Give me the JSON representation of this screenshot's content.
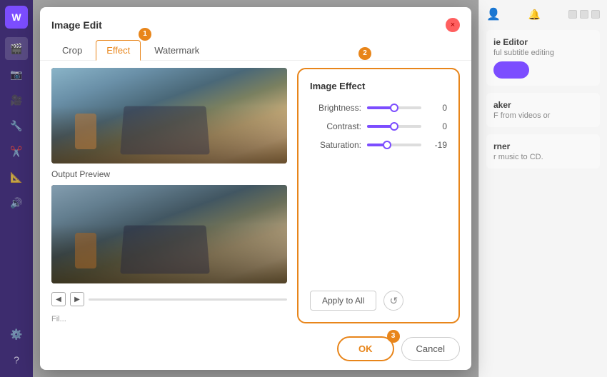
{
  "sidebar": {
    "logo_text": "W",
    "icons": [
      "🎬",
      "📷",
      "🎥",
      "🔧",
      "✂️",
      "📐",
      "🔊",
      "⚙️",
      "?"
    ]
  },
  "dialog": {
    "title": "Image Edit",
    "close_label": "×",
    "tabs": [
      {
        "id": "crop",
        "label": "Crop",
        "active": false
      },
      {
        "id": "effect",
        "label": "Effect",
        "active": true
      },
      {
        "id": "watermark",
        "label": "Watermark",
        "active": false
      }
    ],
    "output_preview_label": "Output Preview",
    "effect_panel": {
      "title": "Image Effect",
      "sliders": [
        {
          "label": "Brightness:",
          "value": 0,
          "position": 50
        },
        {
          "label": "Contrast:",
          "value": 0,
          "position": 50
        },
        {
          "label": "Saturation:",
          "value": -19,
          "position": 37
        }
      ],
      "apply_all_label": "Apply to All",
      "reset_tooltip": "Reset"
    },
    "footer": {
      "ok_label": "OK",
      "cancel_label": "Cancel"
    }
  },
  "right_panel": {
    "title": "ie Editor",
    "subtitle": "ful subtitle editing",
    "section2_title": "aker",
    "section2_text": "F from videos or",
    "section3_title": "rner",
    "section3_text": "r music to CD."
  },
  "badges": {
    "badge1": "1",
    "badge2": "2",
    "badge3": "3"
  }
}
